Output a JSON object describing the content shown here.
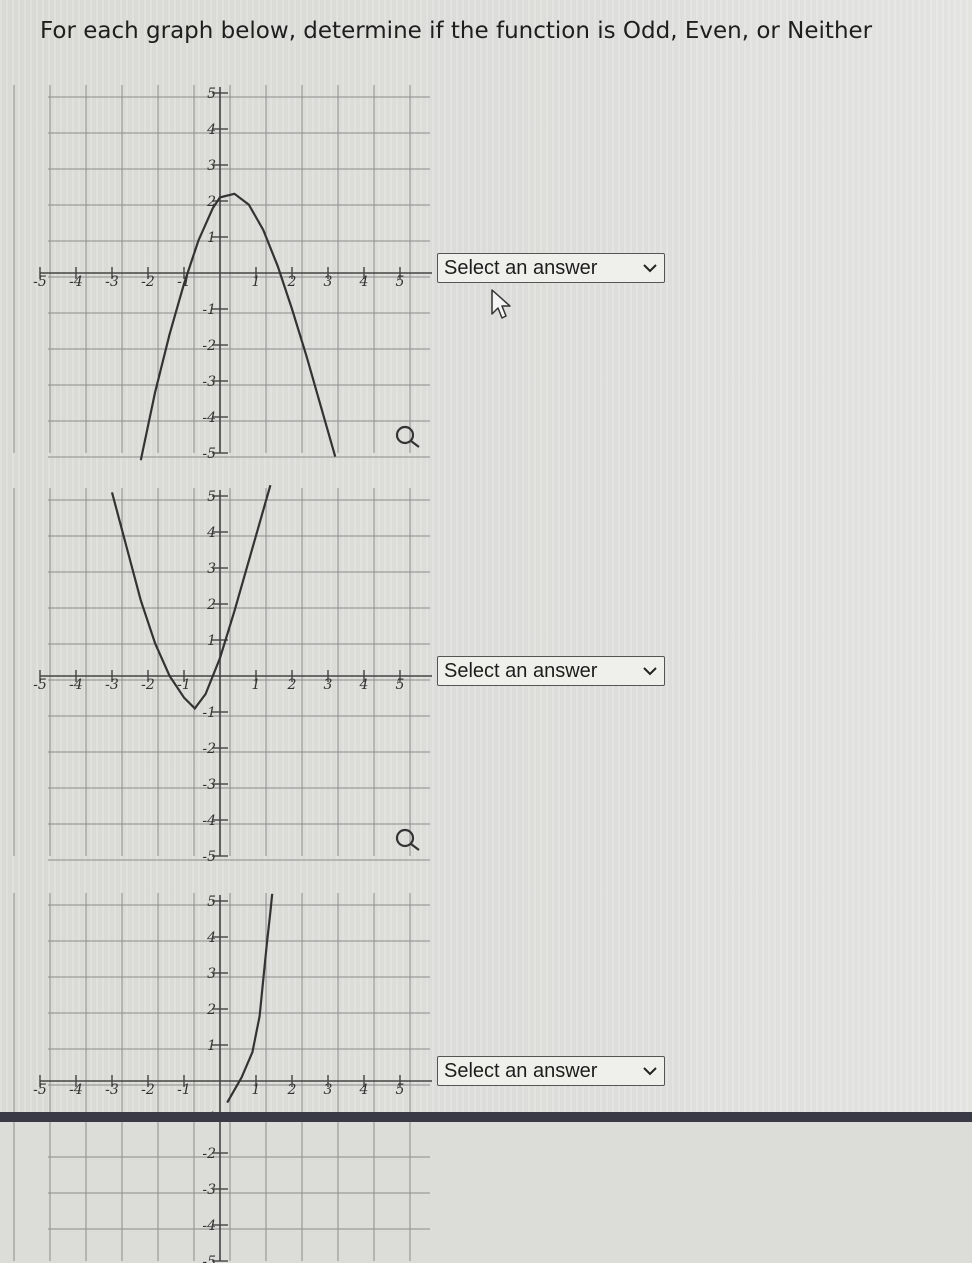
{
  "question": "For each graph below, determine if the function is Odd, Even, or Neither",
  "graphs": [
    {
      "select": {
        "label": "Select an answer"
      },
      "curve_points": [
        [
          -2.2,
          -5.2
        ],
        [
          -1.8,
          -3.3
        ],
        [
          -1.4,
          -1.7
        ],
        [
          -1.0,
          -0.3
        ],
        [
          -0.6,
          0.9
        ],
        [
          -0.2,
          1.8
        ],
        [
          0.0,
          2.1
        ],
        [
          0.4,
          2.2
        ],
        [
          0.8,
          1.9
        ],
        [
          1.2,
          1.2
        ],
        [
          1.6,
          0.2
        ],
        [
          2.0,
          -1.0
        ],
        [
          2.4,
          -2.3
        ],
        [
          2.8,
          -3.7
        ],
        [
          3.2,
          -5.1
        ]
      ]
    },
    {
      "select": {
        "label": "Select an answer"
      },
      "curve_points": [
        [
          -3.0,
          5.1
        ],
        [
          -2.6,
          3.6
        ],
        [
          -2.2,
          2.1
        ],
        [
          -1.8,
          0.9
        ],
        [
          -1.4,
          0.0
        ],
        [
          -1.0,
          -0.6
        ],
        [
          -0.7,
          -0.9
        ],
        [
          -0.4,
          -0.5
        ],
        [
          0.0,
          0.5
        ],
        [
          0.4,
          1.8
        ],
        [
          0.8,
          3.2
        ],
        [
          1.2,
          4.6
        ],
        [
          1.4,
          5.3
        ]
      ]
    },
    {
      "select": {
        "label": "Select an answer"
      },
      "curve_points": [
        [
          0.2,
          -0.6
        ],
        [
          0.6,
          0.1
        ],
        [
          0.9,
          0.8
        ],
        [
          1.1,
          1.8
        ],
        [
          1.2,
          2.8
        ],
        [
          1.3,
          3.8
        ],
        [
          1.4,
          4.7
        ],
        [
          1.45,
          5.2
        ]
      ]
    }
  ],
  "ticks": {
    "x": [
      "-5",
      "-4",
      "-3",
      "-2",
      "-1",
      "1",
      "2",
      "3",
      "4",
      "5"
    ],
    "y": [
      "5",
      "4",
      "3",
      "2",
      "1",
      "-1",
      "-2",
      "-3",
      "-4",
      "-5"
    ]
  },
  "icons": {
    "chevron": "chevron-down-icon",
    "zoom": "magnifier-icon",
    "cursor": "mouse-pointer-icon"
  }
}
